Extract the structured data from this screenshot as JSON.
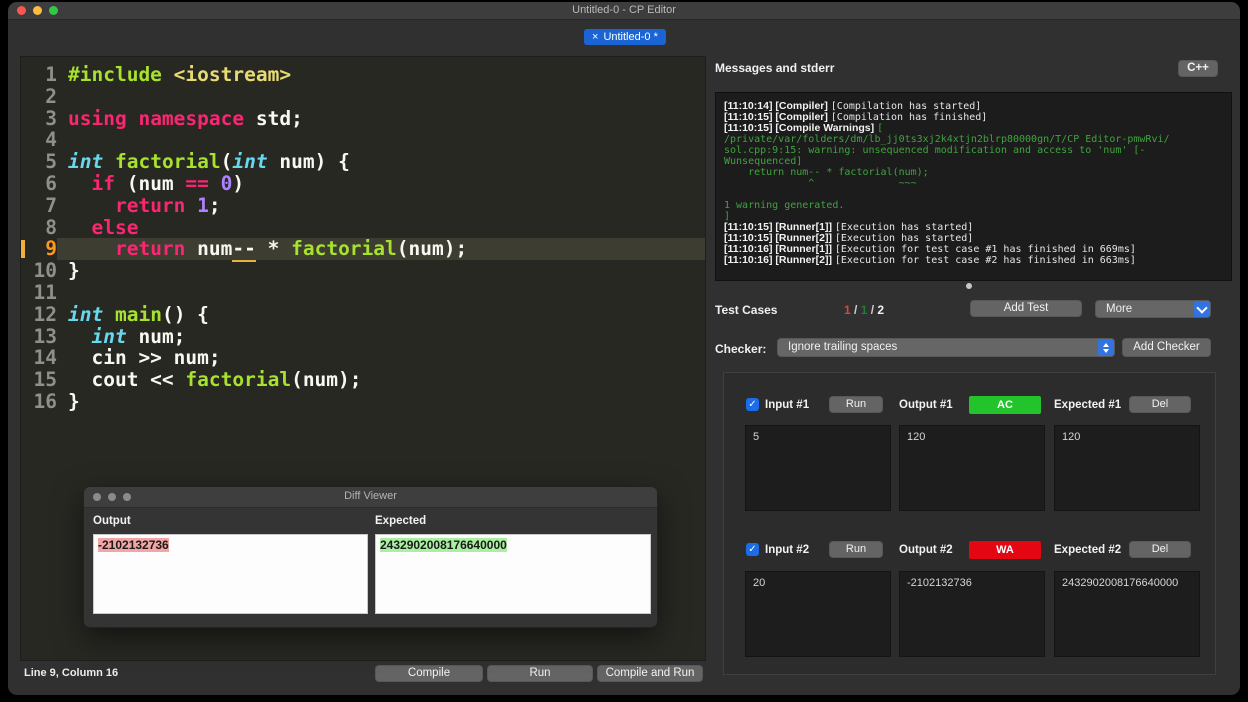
{
  "window": {
    "title": "Untitled-0 - CP Editor"
  },
  "tab": {
    "close": "×",
    "label": "Untitled-0 *"
  },
  "editor": {
    "current_line": 9,
    "lines": [
      {
        "n": 1,
        "tokens": [
          {
            "t": "#include ",
            "c": "pre"
          },
          {
            "t": "<iostream>",
            "c": "s"
          }
        ]
      },
      {
        "n": 2,
        "tokens": []
      },
      {
        "n": 3,
        "tokens": [
          {
            "t": "using",
            "c": "k"
          },
          {
            "t": " ",
            "c": "p"
          },
          {
            "t": "namespace",
            "c": "k"
          },
          {
            "t": " std;",
            "c": "p"
          }
        ]
      },
      {
        "n": 4,
        "tokens": []
      },
      {
        "n": 5,
        "tokens": [
          {
            "t": "int",
            "c": "t"
          },
          {
            "t": " ",
            "c": "p"
          },
          {
            "t": "factorial",
            "c": "f"
          },
          {
            "t": "(",
            "c": "p"
          },
          {
            "t": "int",
            "c": "t"
          },
          {
            "t": " num) {",
            "c": "p"
          }
        ]
      },
      {
        "n": 6,
        "tokens": [
          {
            "t": "  ",
            "c": "p"
          },
          {
            "t": "if",
            "c": "k"
          },
          {
            "t": " (num ",
            "c": "p"
          },
          {
            "t": "==",
            "c": "k"
          },
          {
            "t": " ",
            "c": "p"
          },
          {
            "t": "0",
            "c": "n"
          },
          {
            "t": ")",
            "c": "p"
          }
        ]
      },
      {
        "n": 7,
        "tokens": [
          {
            "t": "    ",
            "c": "p"
          },
          {
            "t": "return",
            "c": "k"
          },
          {
            "t": " ",
            "c": "p"
          },
          {
            "t": "1",
            "c": "n"
          },
          {
            "t": ";",
            "c": "p"
          }
        ]
      },
      {
        "n": 8,
        "tokens": [
          {
            "t": "  ",
            "c": "p"
          },
          {
            "t": "else",
            "c": "k"
          }
        ]
      },
      {
        "n": 9,
        "tokens": [
          {
            "t": "    ",
            "c": "p"
          },
          {
            "t": "return",
            "c": "k"
          },
          {
            "t": " num",
            "c": "p"
          },
          {
            "t": "--",
            "c": "u"
          },
          {
            "t": " * ",
            "c": "p"
          },
          {
            "t": "factorial",
            "c": "f"
          },
          {
            "t": "(num);",
            "c": "p"
          }
        ]
      },
      {
        "n": 10,
        "tokens": [
          {
            "t": "}",
            "c": "p"
          }
        ]
      },
      {
        "n": 11,
        "tokens": []
      },
      {
        "n": 12,
        "tokens": [
          {
            "t": "int",
            "c": "t"
          },
          {
            "t": " ",
            "c": "p"
          },
          {
            "t": "main",
            "c": "f"
          },
          {
            "t": "() {",
            "c": "p"
          }
        ]
      },
      {
        "n": 13,
        "tokens": [
          {
            "t": "  ",
            "c": "p"
          },
          {
            "t": "int",
            "c": "t"
          },
          {
            "t": " num;",
            "c": "p"
          }
        ]
      },
      {
        "n": 14,
        "tokens": [
          {
            "t": "  cin >> num;",
            "c": "p"
          }
        ]
      },
      {
        "n": 15,
        "tokens": [
          {
            "t": "  cout << ",
            "c": "p"
          },
          {
            "t": "factorial",
            "c": "f"
          },
          {
            "t": "(num);",
            "c": "p"
          }
        ]
      },
      {
        "n": 16,
        "tokens": [
          {
            "t": "}",
            "c": "p"
          }
        ]
      }
    ]
  },
  "messages": {
    "header": "Messages and stderr",
    "lang_button": "C++",
    "lines": [
      [
        {
          "t": "[11:10:14] [Compiler] ",
          "c": "b"
        },
        {
          "t": "[Compilation has started]",
          "c": "m"
        }
      ],
      [
        {
          "t": "[11:10:15] [Compiler] ",
          "c": "b"
        },
        {
          "t": "[Compilation has finished]",
          "c": "m"
        }
      ],
      [
        {
          "t": "[11:10:15] [Compile Warnings] ",
          "c": "b"
        },
        {
          "t": "[",
          "c": "g"
        }
      ],
      [
        {
          "t": "/private/var/folders/dm/lb_jj0ts3xj2k4xtjn2blrp80000gn/T/CP Editor-pmwRvi/",
          "c": "g"
        }
      ],
      [
        {
          "t": "sol.cpp:9:15: warning: unsequenced modification and access to 'num' [-",
          "c": "g"
        }
      ],
      [
        {
          "t": "Wunsequenced]",
          "c": "g"
        }
      ],
      [
        {
          "t": "    return num-- * factorial(num);",
          "c": "g"
        }
      ],
      [
        {
          "t": "              ^              ~~~",
          "c": "g"
        }
      ],
      [],
      [
        {
          "t": "1 warning generated.",
          "c": "g"
        }
      ],
      [
        {
          "t": "]",
          "c": "g"
        }
      ],
      [
        {
          "t": "[11:10:15] [Runner[1]] ",
          "c": "b"
        },
        {
          "t": "[Execution has started]",
          "c": "m"
        }
      ],
      [
        {
          "t": "[11:10:15] [Runner[2]] ",
          "c": "b"
        },
        {
          "t": "[Execution has started]",
          "c": "m"
        }
      ],
      [
        {
          "t": "[11:10:16] [Runner[1]] ",
          "c": "b"
        },
        {
          "t": "[Execution for test case #1 has finished in 669ms]",
          "c": "m"
        }
      ],
      [
        {
          "t": "[11:10:16] [Runner[2]] ",
          "c": "b"
        },
        {
          "t": "[Execution for test case #2 has finished in 663ms]",
          "c": "m"
        }
      ]
    ]
  },
  "testcases": {
    "label": "Test Cases",
    "counts": [
      {
        "t": "1",
        "c": "red"
      },
      {
        "t": " / ",
        "c": "mid"
      },
      {
        "t": "1",
        "c": "green"
      },
      {
        "t": " / ",
        "c": "mid"
      },
      {
        "t": "2",
        "c": "light"
      }
    ],
    "add_test": "Add Test",
    "more": "More",
    "checker_label": "Checker:",
    "checker_value": "Ignore trailing spaces",
    "add_checker": "Add Checker",
    "run_label": "Run",
    "del_label": "Del",
    "check_glyph": "✓",
    "cases": [
      {
        "checked": true,
        "input_label": "Input #1",
        "output_label": "Output #1",
        "expected_label": "Expected #1",
        "verdict": "AC",
        "verdict_type": "ac",
        "input": "5",
        "output": "120",
        "expected": "120"
      },
      {
        "checked": true,
        "input_label": "Input #2",
        "output_label": "Output #2",
        "expected_label": "Expected #2",
        "verdict": "WA",
        "verdict_type": "wa",
        "input": "20",
        "output": "-2102132736",
        "expected": "2432902008176640000"
      }
    ]
  },
  "diff_viewer": {
    "title": "Diff Viewer",
    "output_label": "Output",
    "expected_label": "Expected",
    "output_value": "-2102132736",
    "expected_value": "2432902008176640000"
  },
  "statusbar": {
    "position": "Line 9, Column 16",
    "compile": "Compile",
    "run": "Run",
    "compile_and_run": "Compile and Run"
  },
  "colors": {
    "ac_green": "#23c32b",
    "wa_red": "#e50613",
    "tab_blue": "#1a65d3",
    "accent_blue": "#3273e0",
    "warning_green": "#3fa33f",
    "current_line_marker": "#efb03c",
    "diff_removed_bg": "#f2a6a6",
    "diff_added_bg": "#abefa2",
    "editor_bg": "#282823",
    "keyword_pink": "#f92672",
    "type_cyan": "#66d9ef",
    "function_green": "#a6e22e",
    "string_yellow": "#e6db74",
    "number_purple": "#ae81ff"
  }
}
